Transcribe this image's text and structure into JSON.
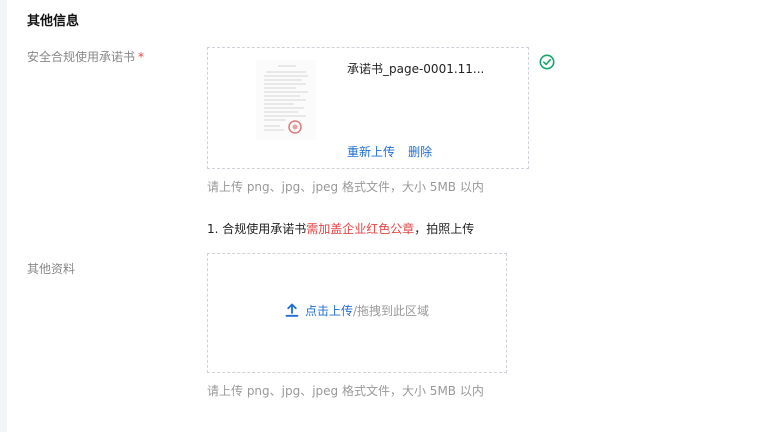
{
  "section": {
    "title": "其他信息"
  },
  "compliance": {
    "label": "安全合规使用承诺书",
    "required_mark": "*",
    "file_name": "承诺书_page-0001.11...",
    "reupload_label": "重新上传",
    "delete_label": "删除",
    "hint": "请上传 png、jpg、jpeg 格式文件，大小 5MB 以内",
    "note_prefix": "1. 合规使用承诺书",
    "note_highlight": "需加盖企业红色公章",
    "note_suffix": "，拍照上传"
  },
  "other": {
    "label": "其他资料",
    "upload_label": "点击上传",
    "drag_text": "/拖拽到此区域",
    "hint": "请上传 png、jpg、jpeg 格式文件，大小 5MB 以内"
  },
  "colors": {
    "link": "#1f6fd1",
    "success": "#14a66a",
    "required": "#e54545"
  }
}
